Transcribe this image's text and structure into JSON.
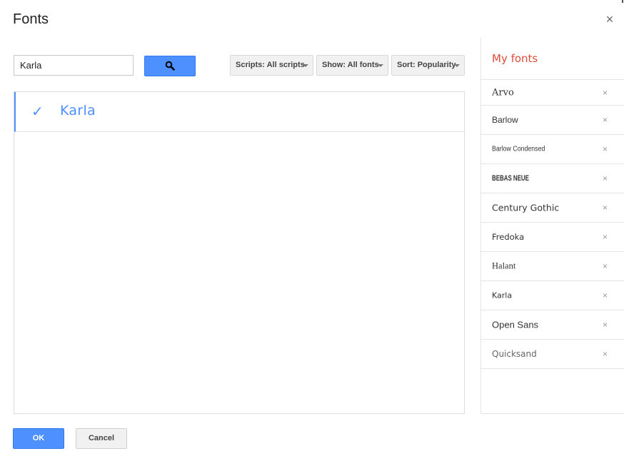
{
  "dialog": {
    "title": "Fonts",
    "close_glyph": "×"
  },
  "search": {
    "value": "Karla",
    "button_icon": "search-icon"
  },
  "filters": {
    "scripts_label": "Scripts: All scripts",
    "show_label": "Show: All fonts",
    "sort_label": "Sort: Popularity"
  },
  "results": [
    {
      "label": "Karla",
      "selected": true,
      "check_glyph": "✓"
    }
  ],
  "my_fonts": {
    "title": "My fonts",
    "remove_glyph": "×",
    "items": [
      {
        "label": "Arvo"
      },
      {
        "label": "Barlow"
      },
      {
        "label": "Barlow Condensed"
      },
      {
        "label": "BEBAS NEUE"
      },
      {
        "label": "Century Gothic"
      },
      {
        "label": "Fredoka"
      },
      {
        "label": "Halant"
      },
      {
        "label": "Karla"
      },
      {
        "label": "Open Sans"
      },
      {
        "label": "Quicksand"
      }
    ]
  },
  "footer": {
    "ok_label": "OK",
    "cancel_label": "Cancel"
  },
  "colors": {
    "accent_blue": "#4d90fe",
    "my_fonts_red": "#dd4b39"
  }
}
